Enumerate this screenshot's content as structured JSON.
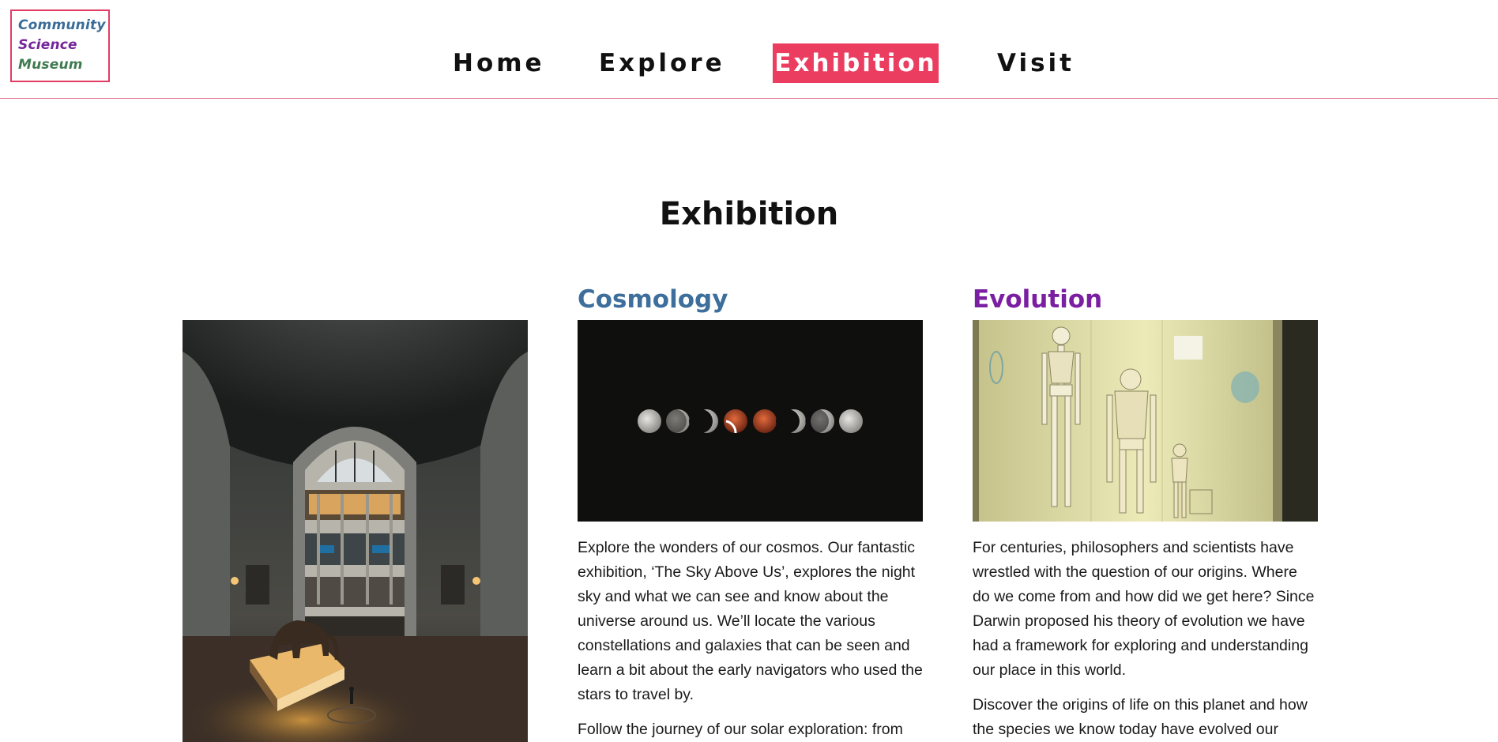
{
  "logo": {
    "line1": "Community",
    "line2": "Science",
    "line3": "Museum"
  },
  "nav": {
    "items": [
      {
        "label": "Home"
      },
      {
        "label": "Explore"
      },
      {
        "label": "Exhibition",
        "active": true
      },
      {
        "label": "Visit"
      }
    ]
  },
  "page": {
    "title": "Exhibition"
  },
  "cards": [
    {
      "title": "Cosmology",
      "paragraphs": [
        "Explore the wonders of our cosmos. Our fantastic exhibition, ‘The Sky Above Us’, explores the night sky and what we can see and know about the universe around us. We’ll locate the various constellations and galaxies that can be seen and learn a bit about the early navigators who used the stars to travel by.",
        "Follow the journey of our solar exploration: from"
      ]
    },
    {
      "title": "Evolution",
      "paragraphs": [
        "For centuries, philosophers and scientists have wrestled with the question of our origins. Where do we come from and how did we get here? Since Darwin proposed his theory of evolution we have had a framework for exploring and understanding our place in this world.",
        "Discover the origins of life on this planet and how the species we know today have evolved our"
      ]
    }
  ],
  "colors": {
    "accent": "#ea3d60",
    "cosmology": "#3d6e9c",
    "evolution": "#7b1fa2",
    "logo_border": "#e23c63"
  }
}
